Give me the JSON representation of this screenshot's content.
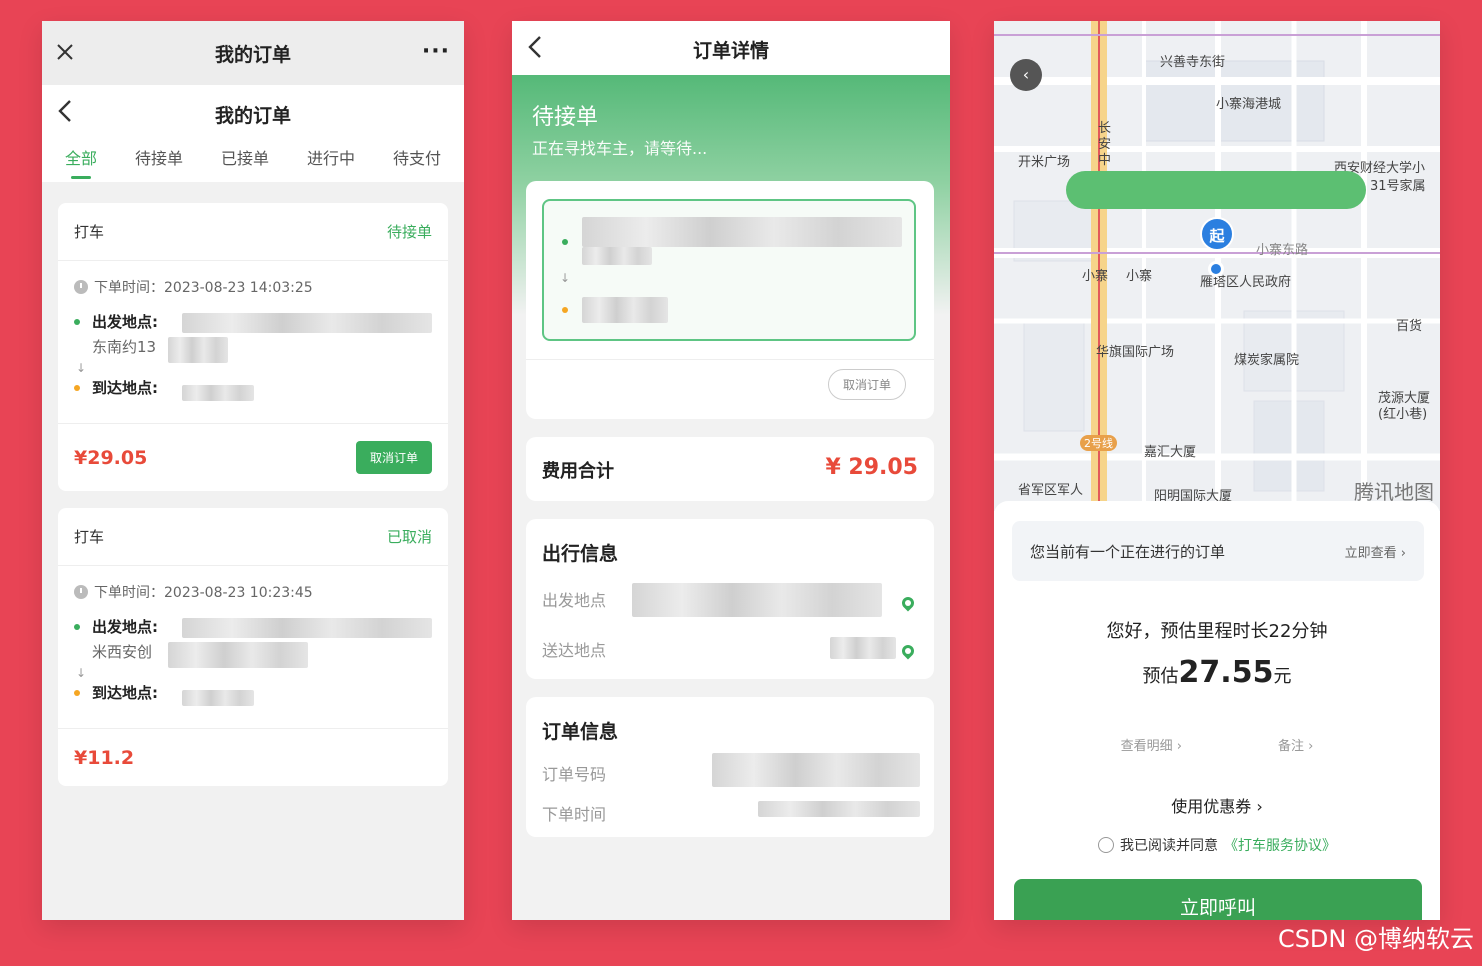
{
  "colors": {
    "background": "#e84455",
    "accent_green": "#3aad5d",
    "price_red": "#e84a3a"
  },
  "panel1": {
    "top_title": "我的订单",
    "close_icon": "close-icon",
    "more_icon": "more-dots-icon",
    "more_text": "···",
    "page_title": "我的订单",
    "tabs": [
      "全部",
      "待接单",
      "已接单",
      "进行中",
      "待支付"
    ],
    "orders": [
      {
        "type": "打车",
        "status": "待接单",
        "time": "下单时间：2023-08-23 14:03:25",
        "from_label": "出发地点:",
        "from_sub": "东南约13",
        "to_label": "到达地点:",
        "price": "¥29.05",
        "action": "取消订单"
      },
      {
        "type": "打车",
        "status": "已取消",
        "time": "下单时间：2023-08-23 10:23:45",
        "from_label": "出发地点:",
        "from_sub": "米西安创",
        "to_label": "到达地点:",
        "price": "¥11.2"
      }
    ]
  },
  "panel2": {
    "nav_title": "订单详情",
    "status_title": "待接单",
    "status_sub": "正在寻找车主，请等待...",
    "cancel_button": "取消订单",
    "fee_label": "费用合计",
    "fee_value": "¥ 29.05",
    "trip_title": "出行信息",
    "trip_from_label": "出发地点",
    "trip_to_label": "送达地点",
    "order_title": "订单信息",
    "order_no_label": "订单号码",
    "order_time_label": "下单时间"
  },
  "panel3": {
    "map_labels": {
      "xingshan": "兴善寺东街",
      "xiaozhai_city": "小寨海港城",
      "kaimi": "开米广场",
      "changan": "长安中",
      "university": "西安财经大学小",
      "jiayuan": "31号家属",
      "xiaozhai_east": "小寨东路",
      "xiaozhai1": "小寨",
      "xiaozhai2": "小寨",
      "district_gov": "雁塔区人民政府",
      "baishi": "百货",
      "huaqi": "华旗国际广场",
      "meitan": "煤炭家属院",
      "maoyuan": "茂源大厦",
      "hongxiang": "(红小巷)",
      "line2": "2号线",
      "jiahui": "嘉汇大厦",
      "shengjun": "省军区军人",
      "yangming": "阳明国际大厦",
      "tencent_map": "腾讯地图"
    },
    "start_marker": "起",
    "notice_text": "您当前有一个正在进行的订单",
    "notice_link": "立即查看 ›",
    "greeting": "您好，预估里程时长22分钟",
    "estimate_prefix": "预估",
    "estimate_value": "27.55",
    "estimate_unit": "元",
    "detail_link": "查看明细 ›",
    "remark_link": "备注 ›",
    "coupon": "使用优惠券 ›",
    "agree_text": "我已阅读并同意",
    "agree_link": "《打车服务协议》",
    "call_button": "立即呼叫"
  },
  "watermark": "CSDN @博纳软云"
}
